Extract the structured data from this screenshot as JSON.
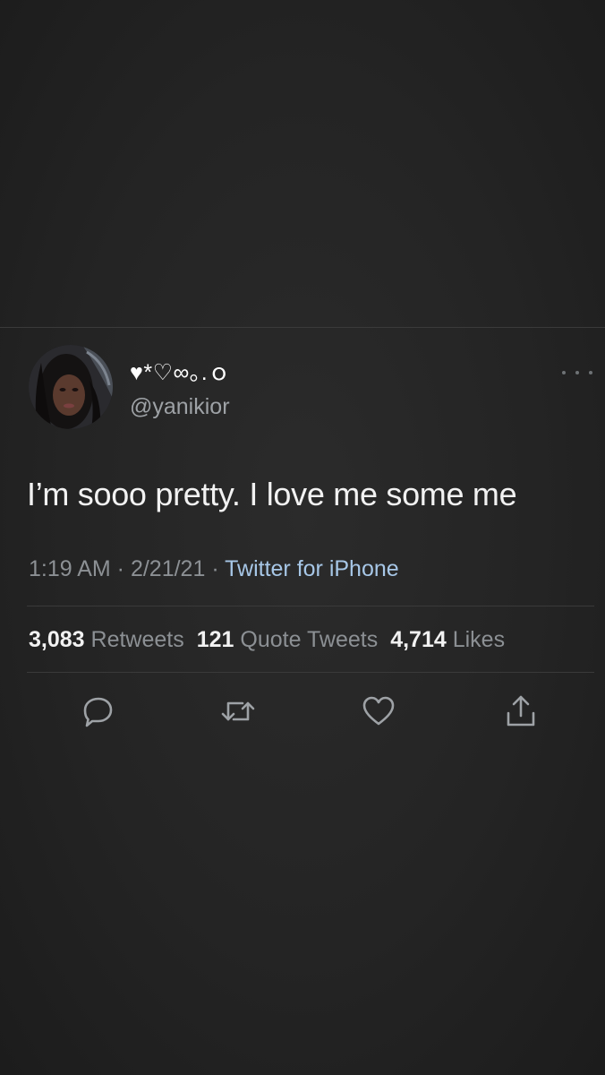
{
  "tweet": {
    "display_name": "♥*♡∞｡.ｏ",
    "handle": "@yanikior",
    "text": "I’m sooo pretty. I love me some me",
    "time": "1:19 AM",
    "separator": " · ",
    "date": "2/21/21",
    "source": "Twitter for iPhone",
    "stats": {
      "retweets_count": "3,083",
      "retweets_label": "Retweets",
      "quotes_count": "121",
      "quotes_label": "Quote Tweets",
      "likes_count": "4,714",
      "likes_label": "Likes"
    },
    "actions": {
      "reply_icon": "reply-icon",
      "retweet_icon": "retweet-icon",
      "like_icon": "heart-icon",
      "share_icon": "share-icon"
    }
  },
  "colors": {
    "background": "#262626",
    "text_primary": "#f2f2f2",
    "text_secondary": "#8c9094",
    "link": "#a7c7e7",
    "divider": "#3a3a3a",
    "icon": "#9ea2a6"
  }
}
